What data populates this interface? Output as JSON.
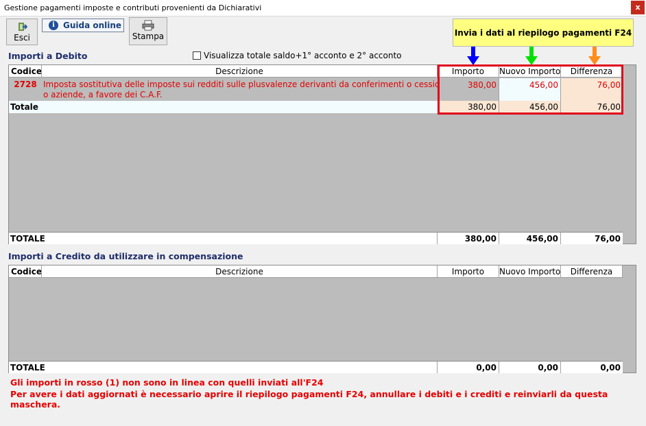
{
  "window": {
    "title": "Gestione pagamenti imposte e contributi provenienti da Dichiarativi",
    "close_label": "x"
  },
  "toolbar": {
    "esci": "Esci",
    "guida": "Guida online",
    "stampa": "Stampa",
    "invia": "Invia i dati al riepilogo pagamenti F24"
  },
  "debito": {
    "title": "Importi a Debito",
    "checkbox_label": "Visualizza totale saldo+1° acconto e 2° acconto",
    "headers": {
      "codice": "Codice",
      "descrizione": "Descrizione",
      "importo": "Importo",
      "nuovo": "Nuovo Importo",
      "differenza": "Differenza"
    },
    "row": {
      "codice": "2728",
      "descrizione_1": "Imposta sostitutiva delle imposte sui redditi sulle plusvalenze derivanti da conferimenti o cessioni di beni",
      "descrizione_2": "o aziende, a favore dei C.A.F.",
      "importo": "380,00",
      "nuovo": "456,00",
      "differenza": "76,00"
    },
    "totale": {
      "label": "Totale",
      "importo": "380,00",
      "nuovo": "456,00",
      "differenza": "76,00"
    },
    "grand_total": {
      "label": "TOTALE",
      "importo": "380,00",
      "nuovo": "456,00",
      "differenza": "76,00"
    }
  },
  "credito": {
    "title": "Importi a Credito da utilizzare in compensazione",
    "headers": {
      "codice": "Codice",
      "descrizione": "Descrizione",
      "importo": "Importo",
      "nuovo": "Nuovo Importo",
      "differenza": "Differenza"
    },
    "grand_total": {
      "label": "TOTALE",
      "importo": "0,00",
      "nuovo": "0,00",
      "differenza": "0,00"
    }
  },
  "footer": {
    "line1": "Gli importi in rosso (1) non sono in linea con quelli inviati all'F24",
    "line2": "Per avere i dati aggiornati è necessario aprire il riepilogo pagamenti F24, annullare i debiti e i crediti e reinviarli da questa maschera."
  },
  "colors": {
    "accent_red": "#e0001b",
    "arrow_blue": "#0000ff",
    "arrow_green": "#00e000",
    "arrow_orange": "#ff8c1a"
  }
}
